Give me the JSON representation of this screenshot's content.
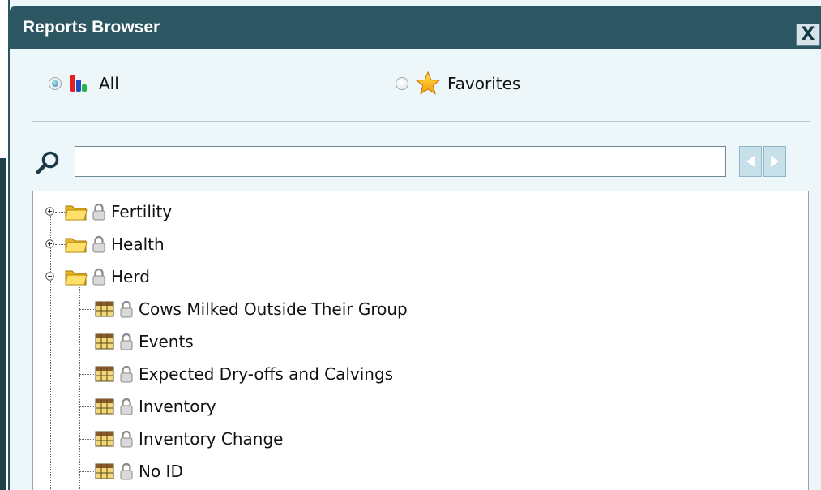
{
  "window": {
    "title": "Reports Browser",
    "close_label": "X"
  },
  "filter": {
    "all_label": "All",
    "favorites_label": "Favorites",
    "selected": "all"
  },
  "search": {
    "value": "",
    "placeholder": ""
  },
  "colors": {
    "titlebar": "#2c5661",
    "background": "#edf6f8",
    "nav_button": "#c7e0ea"
  },
  "tree": {
    "folders": [
      {
        "label": "Fertility",
        "expanded": false,
        "locked": true
      },
      {
        "label": "Health",
        "expanded": false,
        "locked": true
      },
      {
        "label": "Herd",
        "expanded": true,
        "locked": true,
        "children": [
          {
            "label": "Cows Milked Outside Their Group",
            "locked": true
          },
          {
            "label": "Events",
            "locked": true
          },
          {
            "label": "Expected Dry-offs and Calvings",
            "locked": true
          },
          {
            "label": "Inventory",
            "locked": true
          },
          {
            "label": "Inventory Change",
            "locked": true
          },
          {
            "label": "No ID",
            "locked": true
          }
        ]
      }
    ]
  }
}
